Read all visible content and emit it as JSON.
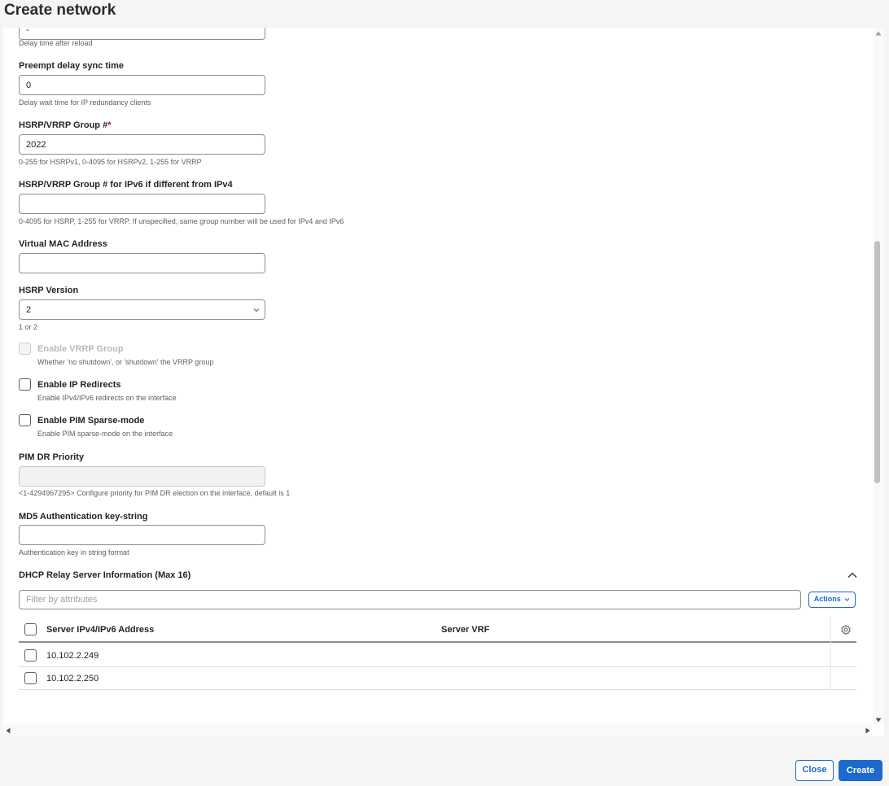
{
  "page": {
    "title": "Create network"
  },
  "fields": {
    "top_partial": {
      "value": "-",
      "help": "Delay time after reload"
    },
    "preempt_delay_sync": {
      "label": "Preempt delay sync time",
      "value": "0",
      "help": "Delay wait time for IP redundancy clients"
    },
    "hsrp_group": {
      "label": "HSRP/VRRP Group #",
      "required_mark": "*",
      "value": "2022",
      "help": "0-255 for HSRPv1, 0-4095 for HSRPv2, 1-255 for VRRP"
    },
    "hsrp_group_ipv6": {
      "label": "HSRP/VRRP Group # for IPv6 if different from IPv4",
      "value": "",
      "help": "0-4095 for HSRP, 1-255 for VRRP. If unspecified, same group number will be used for IPv4 and IPv6"
    },
    "virtual_mac": {
      "label": "Virtual MAC Address",
      "value": ""
    },
    "hsrp_version": {
      "label": "HSRP Version",
      "value": "2",
      "help": "1 or 2"
    },
    "enable_vrrp_group": {
      "label": "Enable VRRP Group",
      "help": "Whether 'no shutdown', or 'shutdown' the VRRP group",
      "checked": false,
      "disabled": true
    },
    "enable_ip_redirects": {
      "label": "Enable IP Redirects",
      "help": "Enable IPv4/IPv6 redirects on the interface",
      "checked": false
    },
    "enable_pim_sparse": {
      "label": "Enable PIM Sparse-mode",
      "help": "Enable PIM sparse-mode on the interface",
      "checked": false
    },
    "pim_dr_priority": {
      "label": "PIM DR Priority",
      "value": "",
      "help": "<1-4294967295> Configure priority for PIM DR election on the interface, default is 1"
    },
    "md5_key": {
      "label": "MD5 Authentication key-string",
      "value": "",
      "help": "Authentication key in string format"
    }
  },
  "dhcp": {
    "title": "DHCP Relay Server Information (Max 16)",
    "filter_placeholder": "Filter by attributes",
    "actions_label": "Actions",
    "columns": [
      "Server IPv4/IPv6 Address",
      "Server VRF"
    ],
    "rows": [
      {
        "address": "10.102.2.249",
        "vrf": ""
      },
      {
        "address": "10.102.2.250",
        "vrf": ""
      }
    ]
  },
  "footer": {
    "close_label": "Close",
    "create_label": "Create"
  },
  "colors": {
    "accent": "#1d69cc",
    "required": "#d0021b"
  }
}
